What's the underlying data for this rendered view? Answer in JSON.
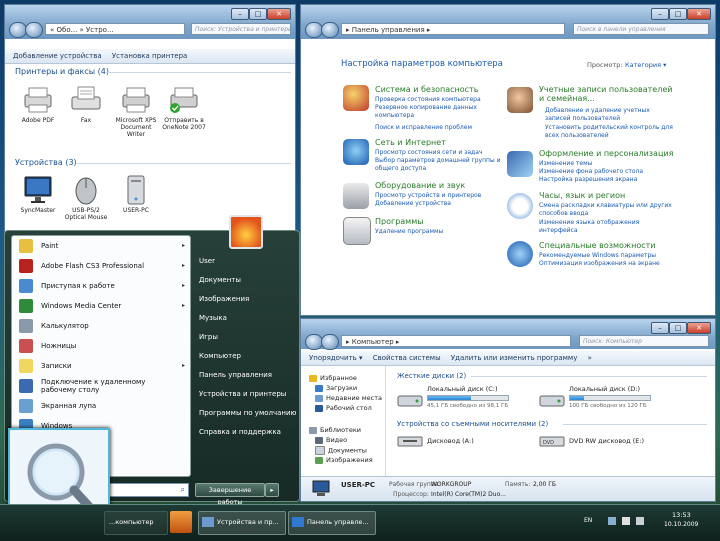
{
  "win1": {
    "address": "« Обо... » Устро...",
    "search_placeholder": "Поиск: Устройства и принтеры",
    "commands": [
      "Добавление устройства",
      "Установка принтера"
    ],
    "group_printers": "Принтеры и факсы (4)",
    "printers": [
      {
        "label": "Adobe PDF",
        "icon": "printer-icon"
      },
      {
        "label": "Fax",
        "icon": "fax-icon"
      },
      {
        "label": "Microsoft XPS Document Writer",
        "icon": "printer-icon"
      },
      {
        "label": "Отправить в OneNote 2007",
        "icon": "printer-default-icon"
      }
    ],
    "group_devices": "Устройства (3)",
    "devices": [
      {
        "label": "SyncMaster",
        "icon": "monitor-icon"
      },
      {
        "label": "USB-PS/2 Optical Mouse",
        "icon": "mouse-icon"
      },
      {
        "label": "USER-PC",
        "icon": "computer-icon"
      }
    ]
  },
  "win2": {
    "address": "▸ Панель управления ▸",
    "search_placeholder": "Поиск в панели управления",
    "heading": "Настройка параметров компьютера",
    "view_by_label": "Просмотр:",
    "view_by_value": "Категория ▾",
    "categories_left": [
      {
        "title": "Система и безопасность",
        "links": [
          "Проверка состояния компьютера",
          "Резервное копирование данных компьютера",
          "Поиск и исправление проблем"
        ],
        "icon": "shield-icon"
      },
      {
        "title": "Сеть и Интернет",
        "links": [
          "Просмотр состояния сети и задач",
          "Выбор параметров домашней группы и общего доступа"
        ],
        "icon": "network-icon"
      },
      {
        "title": "Оборудование и звук",
        "links": [
          "Просмотр устройств и принтеров",
          "Добавление устройства"
        ],
        "icon": "printer-sound-icon"
      },
      {
        "title": "Программы",
        "links": [
          "Удаление программы"
        ],
        "icon": "programs-icon"
      }
    ],
    "categories_right": [
      {
        "title": "Учетные записи пользователей и семейная...",
        "links": [
          "Добавление и удаление учетных записей пользователей",
          "Установить родительский контроль для всех пользователей"
        ],
        "icon": "users-icon"
      },
      {
        "title": "Оформление и персонализация",
        "links": [
          "Изменение темы",
          "Изменение фона рабочего стола",
          "Настройка разрешения экрана"
        ],
        "icon": "personalization-icon"
      },
      {
        "title": "Часы, язык и регион",
        "links": [
          "Смена раскладки клавиатуры или других способов ввода",
          "Изменение языка отображения интерфейса"
        ],
        "icon": "clock-icon"
      },
      {
        "title": "Специальные возможности",
        "links": [
          "Рекомендуемые Windows параметры",
          "Оптимизация изображения на экране"
        ],
        "icon": "accessibility-icon"
      }
    ]
  },
  "win3": {
    "address": "▸ Компьютер ▸",
    "search_placeholder": "Поиск: Компьютер",
    "commands": [
      "Упорядочить ▾",
      "Свойства системы",
      "Удалить или изменить программу",
      "»"
    ],
    "tree": [
      {
        "label": "Избранное",
        "icon": "star-icon"
      },
      {
        "label": "Загрузки",
        "icon": "folder-icon"
      },
      {
        "label": "Недавние места",
        "icon": "folder-icon"
      },
      {
        "label": "Рабочий стол",
        "icon": "desktop-icon"
      },
      {
        "label": "Библиотеки",
        "icon": "library-icon"
      },
      {
        "label": "Видео",
        "icon": "video-icon"
      },
      {
        "label": "Документы",
        "icon": "document-icon"
      },
      {
        "label": "Изображения",
        "icon": "image-icon"
      }
    ],
    "hdd_group": "Жесткие диски (2)",
    "drives": [
      {
        "name": "Локальный диск (C:)",
        "free": "45,1 ГБ свободно из 98,1 ГБ",
        "used_fraction": 0.54
      },
      {
        "name": "Локальный диск (D:)",
        "free": "100 ГБ свободно из 120 ГБ",
        "used_fraction": 0.17
      }
    ],
    "removable_group": "Устройства со съемными носителями (2)",
    "removable": [
      {
        "name": "Дисковод (A:)",
        "icon": "floppy-icon"
      },
      {
        "name": "DVD RW дисковод (E:)",
        "icon": "dvd-icon"
      }
    ],
    "details": {
      "computer_name": "USER-PC",
      "workgroup_label": "Рабочая группа:",
      "workgroup": "WORKGROUP",
      "memory_label": "Память:",
      "memory": "2,00 ГБ",
      "cpu_label": "Процессор:",
      "cpu": "Intel(R) Core(TM)2 Duo..."
    }
  },
  "start_menu": {
    "left_items": [
      {
        "label": "Paint",
        "icon": "paint-icon",
        "color": "#e8c040",
        "arrow": true
      },
      {
        "label": "Adobe Flash CS3 Professional",
        "icon": "flash-icon",
        "color": "#b8221e",
        "arrow": true
      },
      {
        "label": "Приступая к работе",
        "icon": "getting-started-icon",
        "color": "#4a8ad0",
        "arrow": true
      },
      {
        "label": "Windows Media Center",
        "icon": "media-center-icon",
        "color": "#2f8a3a",
        "arrow": true
      },
      {
        "label": "Калькулятор",
        "icon": "calculator-icon",
        "color": "#8a9aab",
        "arrow": false
      },
      {
        "label": "Ножницы",
        "icon": "scissors-icon",
        "color": "#c85050",
        "arrow": false
      },
      {
        "label": "Записки",
        "icon": "notes-icon",
        "color": "#f0d860",
        "arrow": true
      },
      {
        "label": "Подключение к удаленному рабочему столу",
        "icon": "remote-desktop-icon",
        "color": "#3a6ab0",
        "arrow": false
      },
      {
        "label": "Экранная лупа",
        "icon": "magnifier-icon",
        "color": "#6aa0d0",
        "arrow": false
      },
      {
        "label": "Windows",
        "icon": "windows-icon",
        "color": "#3a80c0",
        "arrow": false
      }
    ],
    "right_items": [
      "User",
      "Документы",
      "Изображения",
      "Музыка",
      "Игры",
      "Компьютер",
      "Панель управления",
      "Устройства и принтеры",
      "Программы по умолчанию",
      "Справка и поддержка"
    ],
    "shutdown_label": "Завершение работы",
    "shutdown_arrow": "▸"
  },
  "taskbar": {
    "items": [
      "...компьютер",
      "Устройства и пр...",
      "Панель управле..."
    ],
    "lang": "EN",
    "time": "13:53",
    "date": "10.10.2009"
  },
  "colors": {
    "accent": "#1e5ba8",
    "category_title": "#2a7a2a",
    "link": "#1a5ab0",
    "start_menu": "#1d2f28"
  }
}
